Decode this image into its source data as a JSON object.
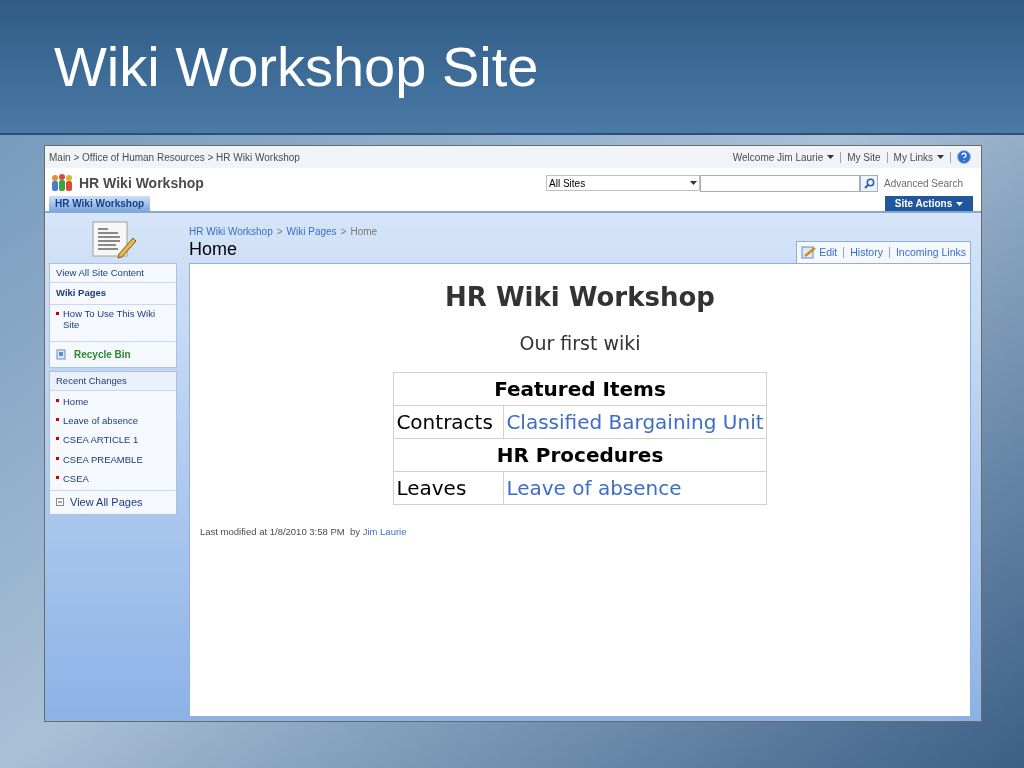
{
  "slide": {
    "title": "Wiki Workshop Site"
  },
  "top_bar": {
    "breadcrumb": "Main > Office of Human Resources > HR Wiki Workshop",
    "links": [
      {
        "label": "Welcome Jim Laurie",
        "dropdown": true
      },
      {
        "label": "My Site",
        "dropdown": false
      },
      {
        "label": "My Links",
        "dropdown": true
      }
    ]
  },
  "header": {
    "site_title": "HR Wiki Workshop",
    "tabs": [
      {
        "label": "HR Wiki Workshop",
        "selected": true
      }
    ],
    "search": {
      "scope": "All Sites",
      "advanced_link": "Advanced Search"
    },
    "site_actions": "Site Actions"
  },
  "page": {
    "breadcrumb": {
      "items": [
        "HR Wiki Workshop",
        "Wiki Pages",
        "Home"
      ],
      "separator": ">"
    },
    "title": "Home",
    "actions": [
      "Edit",
      "History",
      "Incoming Links"
    ]
  },
  "sidebar": {
    "view_all": "View All Site Content",
    "wiki_heading": "Wiki Pages",
    "wiki_items": [
      "How To Use This Wiki Site"
    ],
    "recycle_bin": "Recycle Bin",
    "recent_heading": "Recent Changes",
    "recent_items": [
      "Home",
      "Leave of absence",
      "CSEA ARTICLE 1",
      "CSEA PREAMBLE",
      "CSEA"
    ],
    "view_all_pages": "View All Pages"
  },
  "content": {
    "heading": "HR Wiki Workshop",
    "subheading": "Our first wiki",
    "table": [
      {
        "kind": "header",
        "text": "Featured Items"
      },
      {
        "kind": "row",
        "label": "Contracts",
        "link": "Classified Bargaining Unit"
      },
      {
        "kind": "header",
        "text": "HR Procedures"
      },
      {
        "kind": "row",
        "label": "Leaves",
        "link": "Leave of absence"
      }
    ],
    "modified": {
      "text": "Last modified at 1/8/2010 3:58 PM  by",
      "author": "Jim Laurie"
    }
  }
}
